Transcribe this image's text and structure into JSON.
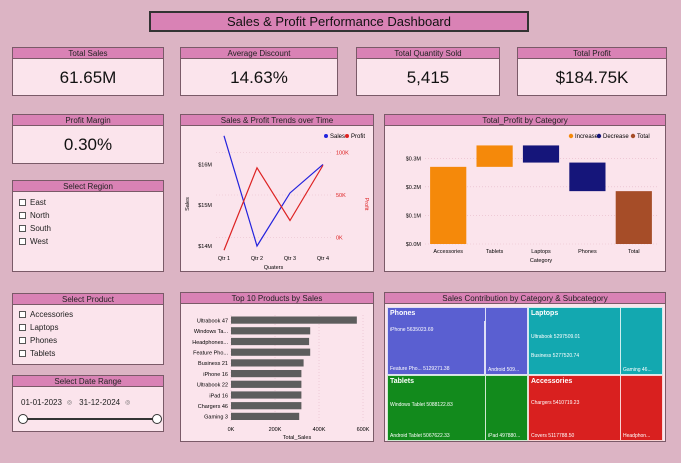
{
  "title": "Sales & Profit Performance Dashboard",
  "kpis": {
    "total_sales": {
      "label": "Total Sales",
      "value": "61.65M"
    },
    "avg_discount": {
      "label": "Average Discount",
      "value": "14.63%"
    },
    "total_qty": {
      "label": "Total Quantity Sold",
      "value": "5,415"
    },
    "total_profit": {
      "label": "Total Profit",
      "value": "$184.75K"
    },
    "profit_margin": {
      "label": "Profit Margin",
      "value": "0.30%"
    }
  },
  "region": {
    "label": "Select Region",
    "items": [
      "East",
      "North",
      "South",
      "West"
    ]
  },
  "product": {
    "label": "Select Product",
    "items": [
      "Accessories",
      "Laptops",
      "Phones",
      "Tablets"
    ]
  },
  "date_range": {
    "label": "Select Date Range",
    "start": "01-01-2023",
    "end": "31-12-2024"
  },
  "colors": {
    "sales": "#2222dd",
    "profit": "#dd2222",
    "increase": "#f5890a",
    "decrease": "#15157a",
    "total": "#a64d28"
  },
  "chart_data": [
    {
      "type": "line",
      "title": "Sales & Profit Trends over Time",
      "xlabel": "Quaters",
      "ylabel": "Sales",
      "y2label": "Profit",
      "categories": [
        "Qtr 1",
        "Qtr 2",
        "Qtr 3",
        "Qtr 4"
      ],
      "y_ticks": [
        "$14M",
        "$15M",
        "$16M"
      ],
      "y2_ticks": [
        "0K",
        "50K",
        "100K"
      ],
      "ylim": [
        14,
        16.5
      ],
      "y2lim": [
        -10,
        110
      ],
      "legend": [
        "Sales",
        "Profit"
      ],
      "series": [
        {
          "name": "Sales",
          "values": [
            16.7,
            14.0,
            15.3,
            16.0
          ]
        },
        {
          "name": "Profit",
          "values": [
            -15,
            82,
            20,
            85
          ]
        }
      ]
    },
    {
      "type": "bar",
      "title": "Total_Profit by Category",
      "xlabel": "Category",
      "legend": [
        "Increase",
        "Decrease",
        "Total"
      ],
      "y_ticks": [
        "$0.0M",
        "$0.1M",
        "$0.2M",
        "$0.3M"
      ],
      "ylim": [
        0,
        0.35
      ],
      "categories": [
        "Accessories",
        "Tablets",
        "Laptops",
        "Phones",
        "Total"
      ],
      "steps": [
        {
          "kind": "Increase",
          "start": 0,
          "end": 0.27
        },
        {
          "kind": "Increase",
          "start": 0.27,
          "end": 0.345
        },
        {
          "kind": "Decrease",
          "start": 0.345,
          "end": 0.285
        },
        {
          "kind": "Decrease",
          "start": 0.285,
          "end": 0.185
        },
        {
          "kind": "Total",
          "start": 0,
          "end": 0.185
        }
      ]
    },
    {
      "type": "bar",
      "title": "Top 10 Products by Sales",
      "xlabel": "Total_Sales",
      "x_ticks": [
        "0K",
        "200K",
        "400K",
        "600K"
      ],
      "xlim": [
        0,
        600
      ],
      "categories": [
        "Ultrabook 47",
        "Windows Ta...",
        "Headphones...",
        "Feature Pho...",
        "Business 21",
        "iPhone 16",
        "Ultrabook 22",
        "iPad 16",
        "Chargers 46",
        "Gaming 3"
      ],
      "values": [
        572,
        360,
        355,
        360,
        330,
        320,
        320,
        320,
        320,
        310
      ]
    }
  ],
  "treemap": {
    "title": "Sales Contribution by Category & Subcategory",
    "groups": [
      {
        "name": "Phones",
        "color": "#5a5fd1",
        "items": [
          "iPhone 5635023.69",
          "Feature Pho... 5129271.38",
          "Android 509..."
        ]
      },
      {
        "name": "Laptops",
        "color": "#13a8b0",
        "items": [
          "Ultrabook 5297509.01",
          "Business 5277520.74",
          "Gaming 46..."
        ]
      },
      {
        "name": "Tablets",
        "color": "#128a1c",
        "items": [
          "Windows Tablet 5088122.83",
          "Android Tablet 5067622.33",
          "iPad 497880..."
        ]
      },
      {
        "name": "Accessories",
        "color": "#d9201f",
        "items": [
          "Chargers 5410719.23",
          "Covers 5117788.50",
          "Headphon..."
        ]
      }
    ]
  }
}
